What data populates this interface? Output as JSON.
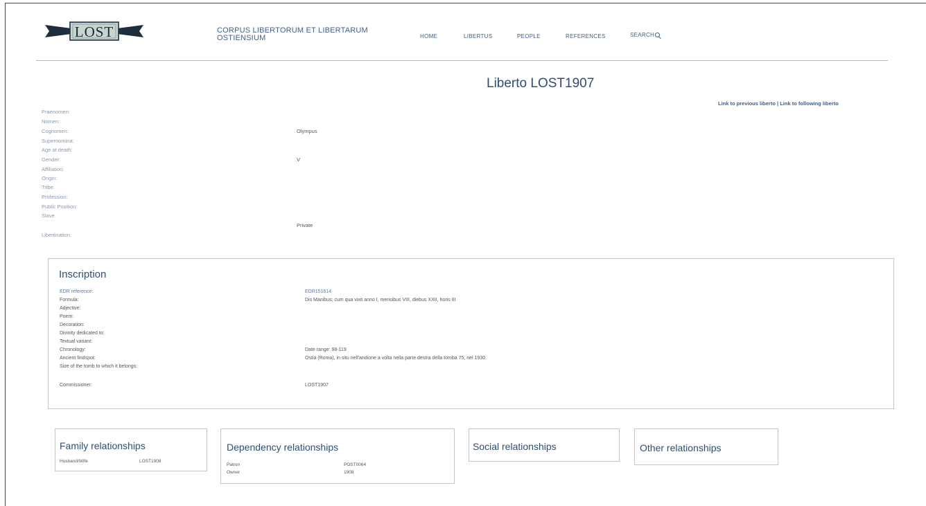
{
  "header": {
    "logo_text": "LOST",
    "site_title_line1": "CORPUS LIBERTORUM ET LIBERTARUM",
    "site_title_line2": "OSTIENSIUM",
    "nav": [
      "HOME",
      "LIBERTUS",
      "PEOPLE",
      "REFERENCES",
      "SEARCH"
    ]
  },
  "page": {
    "title": "Liberto LOST1907",
    "prev_link": "Link to previous liberto",
    "separator": " | ",
    "next_link": "Link to following liberto"
  },
  "libertus": {
    "fields": [
      {
        "label": "Praenomen:",
        "value": ""
      },
      {
        "label": "Nomen:",
        "value": ""
      },
      {
        "label": "Cognomen:",
        "value": "Olympus"
      },
      {
        "label": "Supernomina:",
        "value": ""
      },
      {
        "label": "Age at death:",
        "value": ""
      },
      {
        "label": "Gender:",
        "value": "V"
      },
      {
        "label": "Affiliation:",
        "value": ""
      },
      {
        "label": "Origin:",
        "value": ""
      },
      {
        "label": "Tribe:",
        "value": ""
      },
      {
        "label": "Profession:",
        "value": ""
      },
      {
        "label": "Public Position:",
        "value": ""
      },
      {
        "label": "Slave",
        "value": ""
      },
      {
        "label": "",
        "value": "Private"
      },
      {
        "label": "Libertination:",
        "value": ""
      }
    ]
  },
  "inscription": {
    "heading": "Inscription",
    "rows": [
      {
        "label": "EDR reference:",
        "value": "EDR151614"
      },
      {
        "label": "Formula:",
        "value": "Dis Manibus; cum qua vixit anno I, mensibus VIII, diebus XXII, horis III"
      },
      {
        "label": "Adjective:",
        "value": ""
      },
      {
        "label": "Poem:",
        "value": ""
      },
      {
        "label": "Decoration:",
        "value": ""
      },
      {
        "label": "Divinity dedicated to:",
        "value": ""
      },
      {
        "label": "Textual variant:",
        "value": ""
      },
      {
        "label": "Chronology:",
        "value": "Date range: 98-119"
      },
      {
        "label": "Ancient findspot:",
        "value": "Ostia (Roma), in situ nell'andione a volta nella parte destra della tomba 75, nel 1930."
      },
      {
        "label": "Size of the tomb to which it belongs:",
        "value": ""
      },
      {
        "label": "Commissioner:",
        "value": "LOST1907"
      }
    ]
  },
  "relationships": {
    "family": {
      "heading": "Family relationships",
      "rows": [
        {
          "label": "Husband/Wife",
          "value": "LOST1908"
        }
      ]
    },
    "dependency": {
      "heading": "Dependency relationships",
      "rows": [
        {
          "label": "Patron",
          "value": "POST0064"
        },
        {
          "label": "Owner",
          "value": "1908"
        }
      ]
    },
    "social": {
      "heading": "Social relationships"
    },
    "other": {
      "heading": "Other relationships"
    }
  },
  "colors": {
    "accent": "#3f5f86",
    "heading": "#2f4d73",
    "label_muted": "#8a98ab",
    "border": "#bfc6cf"
  }
}
